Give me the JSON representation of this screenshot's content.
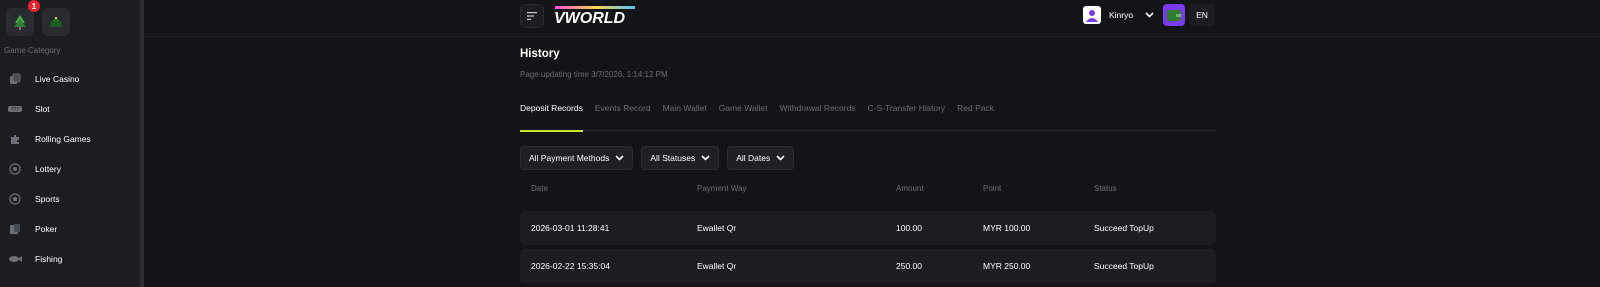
{
  "sidebar": {
    "badge_count": "1",
    "category_title": "Game Category",
    "items": [
      {
        "label": "Live Casino",
        "icon": "cards-icon"
      },
      {
        "label": "Slot",
        "icon": "slot-icon"
      },
      {
        "label": "Rolling Games",
        "icon": "puzzle-icon"
      },
      {
        "label": "Lottery",
        "icon": "lottery-icon"
      },
      {
        "label": "Sports",
        "icon": "ball-icon"
      },
      {
        "label": "Poker",
        "icon": "poker-icon"
      },
      {
        "label": "Fishing",
        "icon": "fish-icon"
      }
    ]
  },
  "header": {
    "logo_text": "VWORLD",
    "username": "Kinryo",
    "language": "EN"
  },
  "page": {
    "title": "History",
    "update_time": "Page updating time 3/7/2026, 1:14:12 PM"
  },
  "tabs": [
    "Deposit Records",
    "Events Record",
    "Main Wallet",
    "Game Wallet",
    "Withdrawal Records",
    "C-S-Transfer History",
    "Red Pack"
  ],
  "filters": [
    "All Payment Methods",
    "All Statuses",
    "All Dates"
  ],
  "table": {
    "headers": [
      "Date",
      "Payment Way",
      "Amount",
      "Point",
      "Status"
    ],
    "rows": [
      [
        "2026-03-01 11:28:41",
        "Ewallet Qr",
        "100.00",
        "MYR 100.00",
        "Succeed TopUp"
      ],
      [
        "2026-02-22 15:35:04",
        "Ewallet Qr",
        "250.00",
        "MYR 250.00",
        "Succeed TopUp"
      ]
    ]
  },
  "colors": {
    "accent": "#c8e632",
    "background": "#131418",
    "panel": "#1c1d22",
    "wallet": "#7c3aed"
  }
}
